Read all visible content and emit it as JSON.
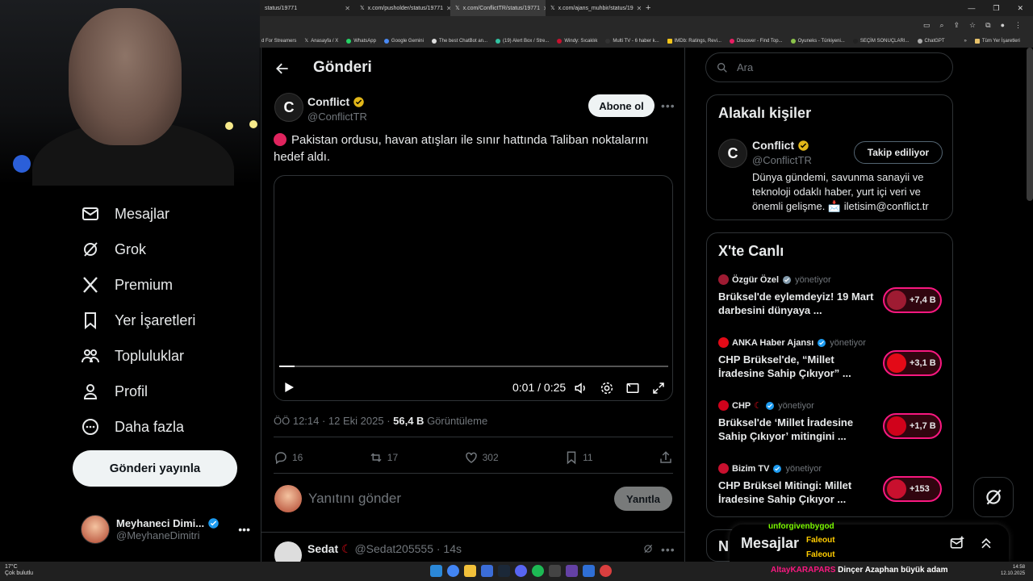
{
  "browser": {
    "tabs": [
      {
        "label": "status/19771"
      },
      {
        "label": "x.com/pusholder/status/19771"
      },
      {
        "label": "x.com/ConflictTR/status/19771"
      },
      {
        "label": "x.com/ajans_muhbir/status/19"
      }
    ],
    "bookmarks": [
      "d For Streamers",
      "Anasayfa / X",
      "WhatsApp",
      "Google Gemini",
      "The best ChatBot an...",
      "(19) Alert Box / Stre...",
      "Windy: Sıcaklık",
      "Multi TV - 6 haber k...",
      "IMDb: Ratings, Revi...",
      "Discover - Find Top...",
      "Oyuneks - Türkiyeni...",
      "SEÇİM SONUÇLARI...",
      "ChatGPT",
      "Tüm Yer İşaretleri"
    ]
  },
  "nav": {
    "items": [
      {
        "label": "Mesajlar"
      },
      {
        "label": "Grok"
      },
      {
        "label": "Premium"
      },
      {
        "label": "Yer İşaretleri"
      },
      {
        "label": "Topluluklar"
      },
      {
        "label": "Profil"
      },
      {
        "label": "Daha fazla"
      }
    ],
    "post_button": "Gönderi yayınla",
    "account": {
      "name": "Meyhaneci Dimi...",
      "handle": "@MeyhaneDimitri"
    }
  },
  "main": {
    "title": "Gönderi",
    "author": {
      "name": "Conflict",
      "handle": "@ConflictTR",
      "subscribe": "Abone ol",
      "initial": "C"
    },
    "text": "Pakistan ordusu, havan atışları ile sınır hattında Taliban noktalarını hedef aldı.",
    "video": {
      "time": "0:01 / 0:25",
      "progress": 0.04
    },
    "meta": {
      "time": "ÖÖ 12:14 · 12 Eki 2025 · ",
      "views": "56,4 B",
      "views_label": " Görüntüleme"
    },
    "actions": {
      "replies": "16",
      "reposts": "17",
      "likes": "302",
      "bookmarks": "11"
    },
    "reply": {
      "placeholder": "Yanıtını gönder",
      "button": "Yanıtla"
    },
    "next_reply": {
      "name": "Sedat",
      "handle": "@Sedat205555 · 14s"
    }
  },
  "sidebar": {
    "search_placeholder": "Ara",
    "related": {
      "title": "Alakalı kişiler",
      "name": "Conflict",
      "handle": "@ConflictTR",
      "follow": "Takip ediliyor",
      "bio": "Dünya gündemi, savunma sanayii ve teknoloji odaklı haber, yurt içi veri ve önemli gelişme. 📩 iletisim@conflict.tr"
    },
    "live": {
      "title": "X'te Canlı",
      "role": "yönetiyor",
      "items": [
        {
          "host": "Özgür Özel",
          "title": "Brüksel'de eylemdeyiz! 19 Mart darbesini dünyaya ...",
          "count": "+7,4 B",
          "color": "#9e1b32"
        },
        {
          "host": "ANKA Haber Ajansı",
          "title": "CHP Brüksel'de, “Millet İradesine Sahip Çıkıyor” ...",
          "count": "+3,1 B",
          "color": "#e30a17"
        },
        {
          "host": "CHP",
          "title": "Brüksel'de ‘Millet İradesine Sahip Çıkıyor’ mitingini ...",
          "count": "+1,7 B",
          "color": "#d0021b"
        },
        {
          "host": "Bizim TV",
          "title": "CHP Brüksel Mitingi: Millet İradesine Sahip Çıkıyor ...",
          "count": "+153",
          "color": "#c8102e"
        }
      ]
    },
    "next_heading": "N"
  },
  "messages_drawer": {
    "title": "Mesajlar"
  },
  "stream_chat": [
    {
      "user": "unforgivenbygod",
      "color": "#7cfc00"
    },
    {
      "user": "Faleout",
      "color": "#ffcc00"
    },
    {
      "user": "Faleout",
      "color": "#ffcc00"
    }
  ],
  "taskbar": {
    "weather": "17°C",
    "weather_desc": "Çok bulutlu",
    "ticker_user": "AltayKARAPARS",
    "ticker_text": "Dinçer Azaphan büyük adam",
    "time": "14:58",
    "date": "12.10.2025"
  }
}
